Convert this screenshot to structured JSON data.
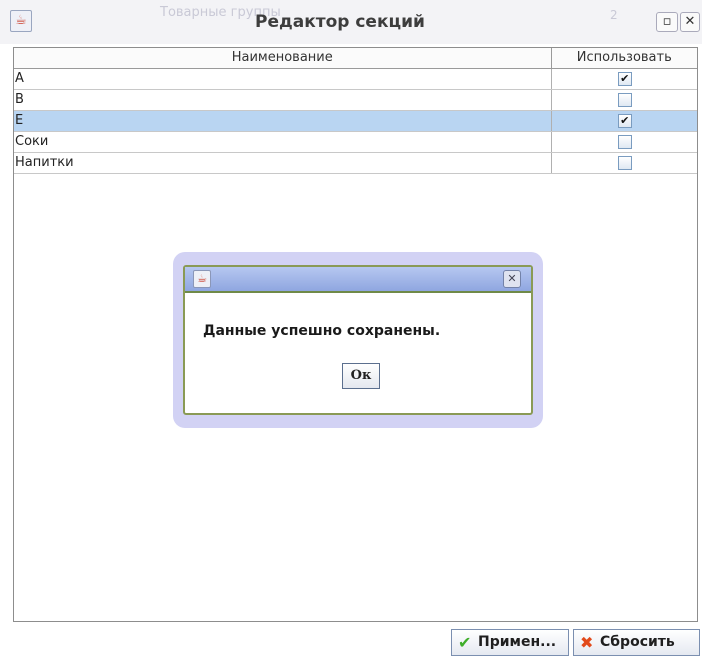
{
  "window": {
    "title": "Редактор секций",
    "ghost_title": "Товарные группы",
    "ghost_right": "2"
  },
  "table": {
    "columns": [
      "Наименование",
      "Использовать"
    ],
    "rows": [
      {
        "name": "A",
        "use": "✔"
      },
      {
        "name": "B",
        "use": ""
      },
      {
        "name": "E",
        "use": "✔"
      },
      {
        "name": "Соки",
        "use": ""
      },
      {
        "name": "Напитки",
        "use": ""
      }
    ]
  },
  "dialog": {
    "message": "Данные успешно сохранены.",
    "ok_label": "Ок",
    "close_glyph": "✕"
  },
  "footer": {
    "apply_label": "Примен...",
    "reset_label": "Сбросить"
  },
  "colors": {
    "selected_row": "#b9d5f2",
    "apply_icon": "#3fae2a",
    "reset_icon": "#e24a1a"
  }
}
